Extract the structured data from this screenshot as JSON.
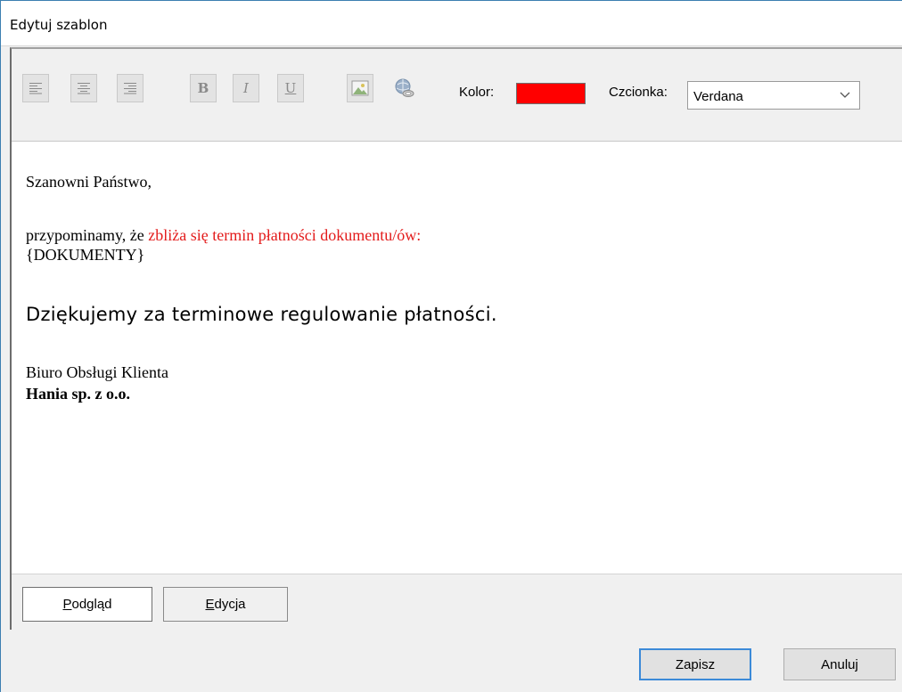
{
  "window": {
    "title": "Edytuj szablon"
  },
  "toolbar": {
    "buttons": [
      {
        "icon": "align-left-icon"
      },
      {
        "icon": "align-center-icon"
      },
      {
        "icon": "align-right-icon"
      },
      {
        "icon": "bold-icon",
        "glyph": "B"
      },
      {
        "icon": "italic-icon",
        "glyph": "I"
      },
      {
        "icon": "underline-icon",
        "glyph": "U"
      },
      {
        "icon": "insert-image-icon"
      },
      {
        "icon": "insert-link-icon"
      }
    ],
    "color_label": "Kolor:",
    "color_value": "#ff0000",
    "font_label": "Czcionka:",
    "font_value": "Verdana"
  },
  "content": {
    "greeting": "Szanowni Państwo,",
    "reminder_prefix": "przypominamy, że ",
    "reminder_highlight": "zbliża się termin płatności dokumentu/ów:",
    "placeholder": "{DOKUMENTY}",
    "thanks": "Dziękujemy za terminowe regulowanie płatności.",
    "signature_line1": "Biuro Obsługi Klienta",
    "signature_line2": "Hania sp. z o.o.",
    "highlight_color": "#e31b1b"
  },
  "tabs": {
    "preview_label": "Podgląd",
    "edit_label": "Edycja",
    "active": "preview"
  },
  "dialog_buttons": {
    "save_label": "Zapisz",
    "cancel_label": "Anuluj"
  }
}
